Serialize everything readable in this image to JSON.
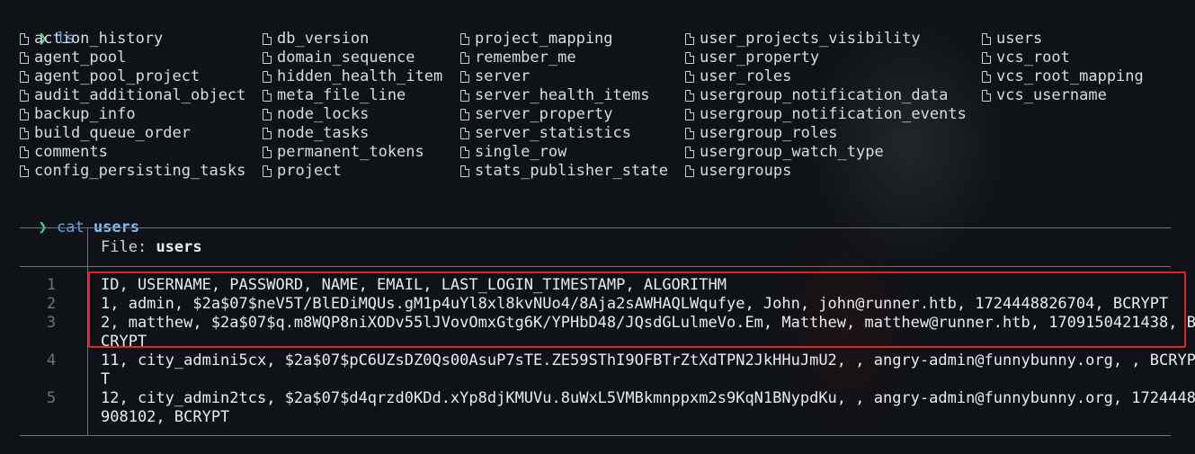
{
  "terminal": {
    "prompt_symbol": "❯",
    "command1": {
      "cmd": "ls",
      "arg": ""
    },
    "ls_columns": [
      [
        "action_history",
        "agent_pool",
        "agent_pool_project",
        "audit_additional_object",
        "backup_info",
        "build_queue_order",
        "comments",
        "config_persisting_tasks"
      ],
      [
        "db_version",
        "domain_sequence",
        "hidden_health_item",
        "meta_file_line",
        "node_locks",
        "node_tasks",
        "permanent_tokens",
        "project"
      ],
      [
        "project_mapping",
        "remember_me",
        "server",
        "server_health_items",
        "server_property",
        "server_statistics",
        "single_row",
        "stats_publisher_state"
      ],
      [
        "user_projects_visibility",
        "user_property",
        "user_roles",
        "usergroup_notification_data",
        "usergroup_notification_events",
        "usergroup_roles",
        "usergroup_watch_type",
        "usergroups"
      ],
      [
        "users",
        "vcs_root",
        "vcs_root_mapping",
        "vcs_username"
      ]
    ],
    "command2": {
      "cmd": "cat",
      "arg": "users"
    },
    "file_view": {
      "header_label": "File:",
      "header_file": "users",
      "lines": [
        {
          "num": "1",
          "wrapped": [
            "ID, USERNAME, PASSWORD, NAME, EMAIL, LAST_LOGIN_TIMESTAMP, ALGORITHM"
          ]
        },
        {
          "num": "2",
          "wrapped": [
            "1, admin, $2a$07$neV5T/BlEDiMQUs.gM1p4uYl8xl8kvNUo4/8Aja2sAWHAQLWqufye, John, john@runner.htb, 1724448826704, BCRYPT"
          ]
        },
        {
          "num": "3",
          "wrapped": [
            "2, matthew, $2a$07$q.m8WQP8niXODv55lJVovOmxGtg6K/YPHbD48/JQsdGLulmeVo.Em, Matthew, matthew@runner.htb, 1709150421438, B",
            "CRYPT"
          ]
        },
        {
          "num": "4",
          "wrapped": [
            "11, city_admini5cx, $2a$07$pC6UZsDZ0Qs00AsuP7sTE.ZE59SThI9OFBTrZtXdTPN2JkHHuJmU2, , angry-admin@funnybunny.org, , BCRYP",
            "T"
          ]
        },
        {
          "num": "5",
          "wrapped": [
            "12, city_admin2tcs, $2a$07$d4qrzd0KDd.xYp8djKMUVu.8uWxL5VMBkmnppxm2s9KqN1BNypdKu, , angry-admin@funnybunny.org, 1724448",
            "908102, BCRYPT"
          ]
        }
      ]
    },
    "colors": {
      "prompt": "#3fd77c",
      "command": "#5aa7f2",
      "highlight_box": "#e0232b"
    }
  }
}
